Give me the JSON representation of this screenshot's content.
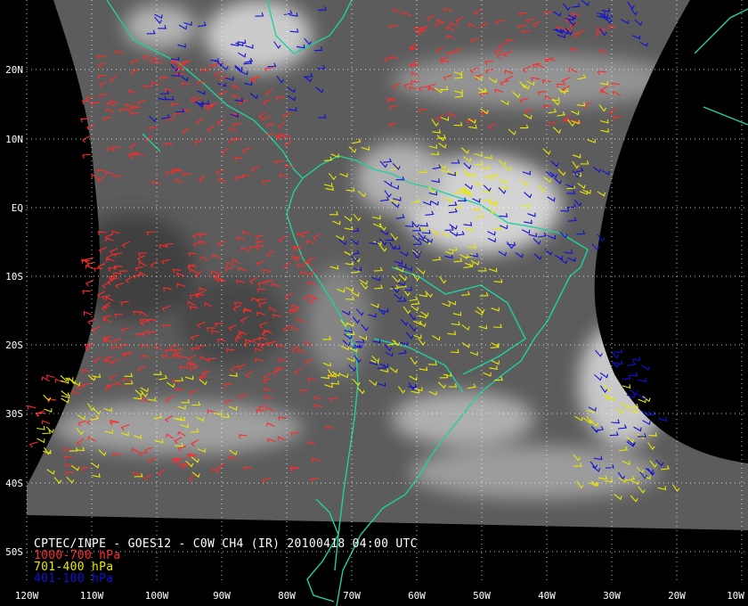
{
  "product": {
    "title": "CPTEC/INPE - GOES12 - C0W CH4 (IR) 20100418 04:00 UTC"
  },
  "legend": [
    {
      "label": "1000-700 hPa",
      "color": "#ff2a2a"
    },
    {
      "label": "701-400 hPa",
      "color": "#e8e800"
    },
    {
      "label": "401-100 hPa",
      "color": "#1010d8"
    }
  ],
  "colors": {
    "background": "#000000",
    "coastline": "#20d0a0",
    "grid": "#ffffff",
    "label_text": "#ffffff"
  },
  "axes": {
    "latitude_labels": [
      "20N",
      "10N",
      "EQ",
      "10S",
      "20S",
      "30S",
      "40S",
      "50S"
    ],
    "longitude_labels": [
      "120W",
      "110W",
      "100W",
      "90W",
      "80W",
      "70W",
      "60W",
      "50W",
      "40W",
      "30W",
      "20W",
      "10W"
    ]
  },
  "map": {
    "lon_range": [
      -120,
      -10
    ],
    "lat_range": [
      -55,
      28
    ],
    "grid_spacing_deg": 10
  }
}
